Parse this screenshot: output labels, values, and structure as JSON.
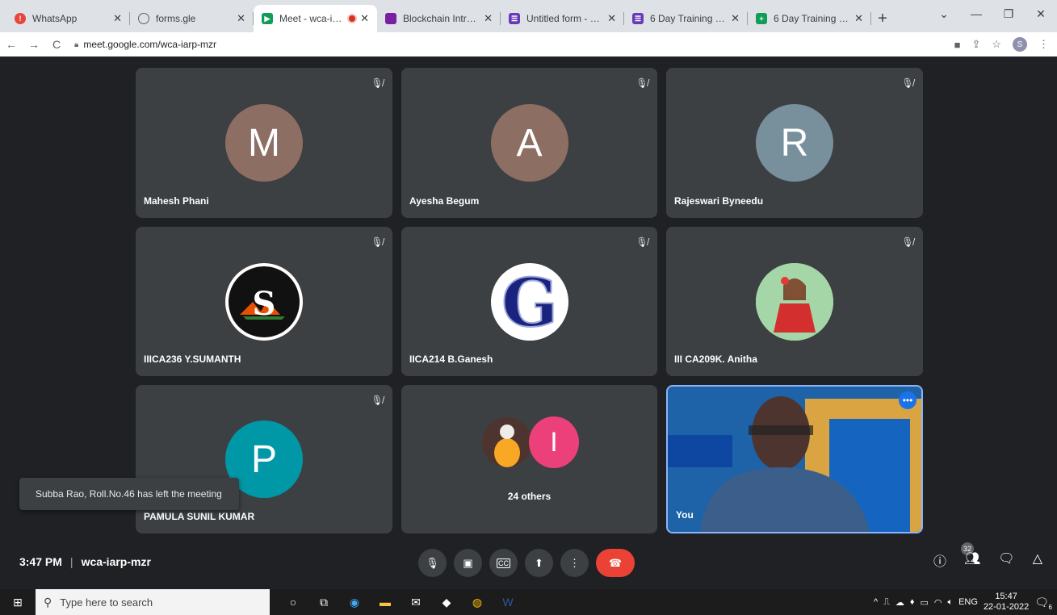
{
  "browser": {
    "tabs": [
      {
        "title": "WhatsApp",
        "favicon_color": "#e8453c",
        "icon": "alert-icon"
      },
      {
        "title": "forms.gle",
        "favicon_color": "#5f6368",
        "icon": "globe-icon"
      },
      {
        "title": "Meet - wca-iarp-",
        "favicon_color": "#0f9d58",
        "icon": "meet-icon",
        "recording": true
      },
      {
        "title": "Blockchain Introductio",
        "favicon_color": "#7b1fa2",
        "icon": "presentation-icon"
      },
      {
        "title": "Untitled form - Googl",
        "favicon_color": "#673ab7",
        "icon": "forms-icon"
      },
      {
        "title": "6 Day Training Progra",
        "favicon_color": "#673ab7",
        "icon": "forms-icon"
      },
      {
        "title": "6 Day Training Progra",
        "favicon_color": "#0f9d58",
        "icon": "sheets-icon"
      }
    ],
    "url": "meet.google.com/wca-iarp-mzr",
    "profile_initial": "S"
  },
  "participants": [
    {
      "name": "Mahesh Phani",
      "initial": "M",
      "color": "#8d6e63"
    },
    {
      "name": "Ayesha Begum",
      "initial": "A",
      "color": "#8d6e63"
    },
    {
      "name": "Rajeswari Byneedu",
      "initial": "R",
      "color": "#78909c"
    },
    {
      "name": "IIICA236 Y.SUMANTH",
      "initial": "S",
      "color": "#111111"
    },
    {
      "name": "IICA214 B.Ganesh",
      "initial": "G",
      "color": "#ffffff"
    },
    {
      "name": "III CA209K. Anitha",
      "initial": "",
      "color": "#bcd9c3"
    },
    {
      "name": "PAMULA SUNIL KUMAR",
      "initial": "P",
      "color": "#0097a7"
    }
  ],
  "others": {
    "label": "24 others",
    "initial": "I",
    "color": "#ec407a"
  },
  "self": {
    "label": "You"
  },
  "toast": "Subba Rao, Roll.No.46 has left the meeting",
  "meeting": {
    "time": "3:47 PM",
    "code": "wca-iarp-mzr",
    "people_count": "32"
  },
  "taskbar": {
    "search_placeholder": "Type here to search",
    "language": "ENG",
    "time": "15:47",
    "date": "22-01-2022",
    "notifications": "6"
  }
}
